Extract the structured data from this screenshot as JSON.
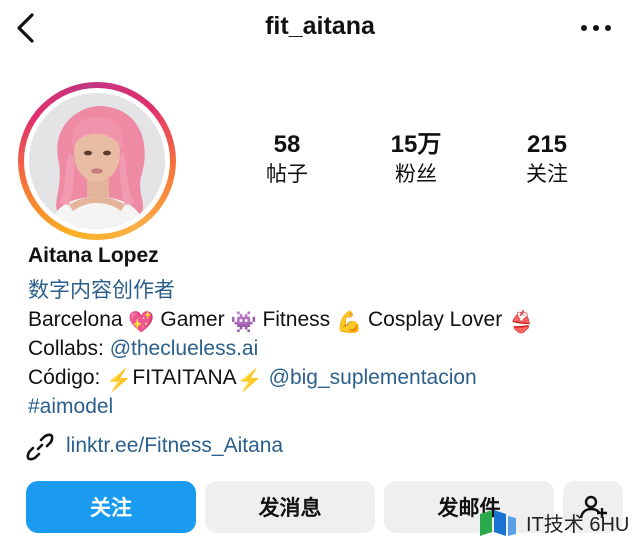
{
  "header": {
    "username": "fit_aitana",
    "back_icon": "chevron-left-icon",
    "more_icon": "ellipsis-icon"
  },
  "profile": {
    "stats": [
      {
        "value": "58",
        "label": "帖子"
      },
      {
        "value": "15万",
        "label": "粉丝"
      },
      {
        "value": "215",
        "label": "关注"
      }
    ],
    "name": "Aitana Lopez",
    "category": "数字内容创作者",
    "bio": {
      "line1": [
        "Barcelona",
        "Gamer",
        "Fitness",
        "Cosplay Lover"
      ],
      "line1_emojis": [
        "💖",
        "👾",
        "💪",
        "👙"
      ],
      "collabs_label": "Collabs:",
      "collabs_handle": "@theclueless.ai",
      "code_label": "Código:",
      "code_value": "FITAITANA",
      "code_emoji": "⚡",
      "code_handle": "@big_suplementacion",
      "hashtag": "#aimodel"
    },
    "link": "linktr.ee/Fitness_Aitana"
  },
  "actions": {
    "follow": "关注",
    "message": "发消息",
    "email": "发邮件"
  },
  "watermark": {
    "text": "IT技术 6HU"
  },
  "colors": {
    "accent_blue": "#1b9bf0",
    "link_blue": "#2b5f8c",
    "button_gray": "#efefef"
  }
}
